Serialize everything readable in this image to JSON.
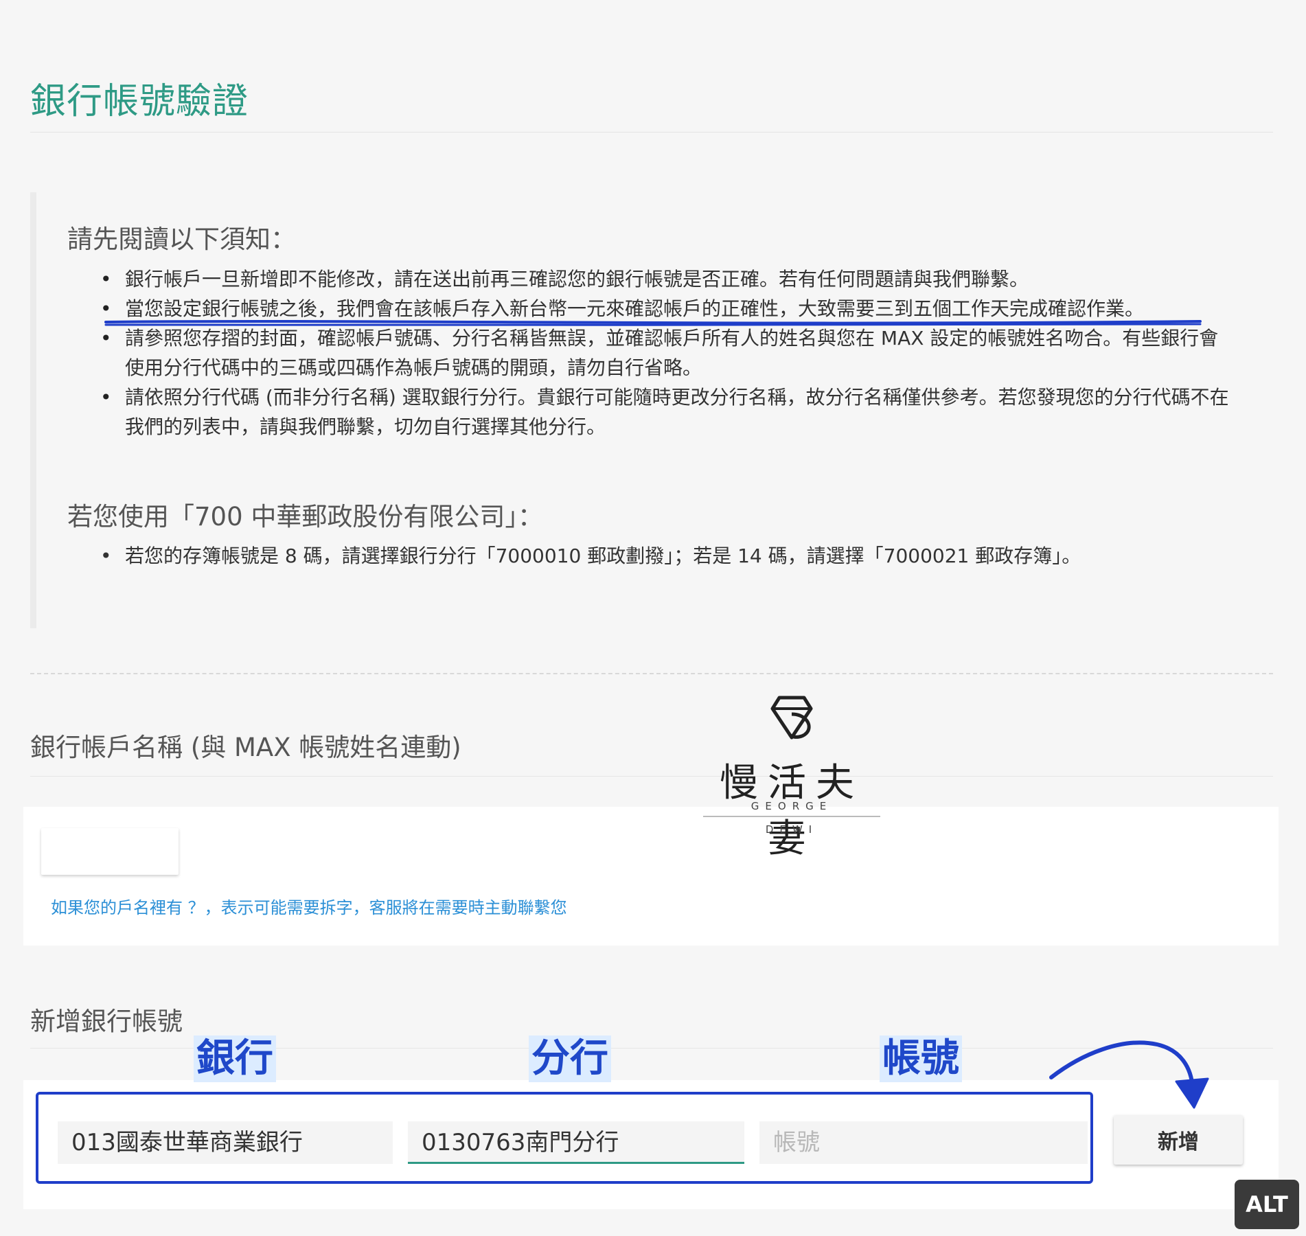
{
  "page": {
    "title": "銀行帳號驗證"
  },
  "notice": {
    "heading": "請先閱讀以下須知：",
    "items": [
      "銀行帳戶一旦新增即不能修改，請在送出前再三確認您的銀行帳號是否正確。若有任何問題請與我們聯繫。",
      "當您設定銀行帳號之後，我們會在該帳戶存入新台幣一元來確認帳戶的正確性，大致需要三到五個工作天完成確認作業。",
      "請參照您存摺的封面，確認帳戶號碼、分行名稱皆無誤，並確認帳戶所有人的姓名與您在 MAX 設定的帳號姓名吻合。有些銀行會使用分行代碼中的三碼或四碼作為帳戶號碼的開頭，請勿自行省略。",
      "請依照分行代碼 (而非分行名稱) 選取銀行分行。貴銀行可能隨時更改分行名稱，故分行名稱僅供參考。若您發現您的分行代碼不在我們的列表中，請與我們聯繫，切勿自行選擇其他分行。"
    ],
    "post_heading": "若您使用「700 中華郵政股份有限公司」：",
    "post_items": [
      "若您的存簿帳號是 8 碼，請選擇銀行分行「7000010 郵政劃撥」；若是 14 碼，請選擇「7000021 郵政存簿」。"
    ]
  },
  "account_name": {
    "heading": "銀行帳戶名稱 (與 MAX 帳號姓名連動)",
    "value": "",
    "hint": "如果您的戶名裡有 ？，表示可能需要拆字，客服將在需要時主動聯繫您"
  },
  "watermark": {
    "text": "慢活夫妻",
    "en_line1": "GEORGE",
    "en_line2": "DEWI"
  },
  "add_account": {
    "heading": "新增銀行帳號",
    "labels": {
      "bank": "銀行",
      "branch": "分行",
      "account": "帳號"
    },
    "bank_value": "013國泰世華商業銀行",
    "branch_value": "0130763南門分行",
    "account_placeholder": "帳號",
    "submit_label": "新增"
  },
  "alt_badge": "ALT",
  "colors": {
    "title": "#2e9a85",
    "link": "#2b8fd6",
    "annotation": "#1f3ec9",
    "label_bg": "#dcecff"
  }
}
